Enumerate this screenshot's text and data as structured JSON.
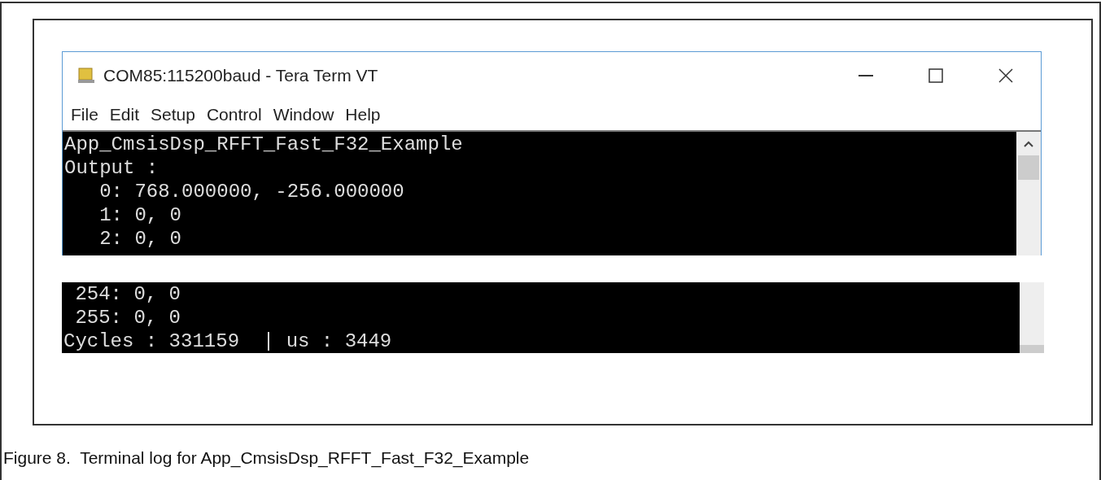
{
  "window": {
    "title": "COM85:115200baud - Tera Term VT"
  },
  "menu": [
    "File",
    "Edit",
    "Setup",
    "Control",
    "Window",
    "Help"
  ],
  "terminal_top": {
    "lines": [
      "App_CmsisDsp_RFFT_Fast_F32_Example",
      "Output :",
      "   0: 768.000000, -256.000000",
      "   1: 0, 0",
      "   2: 0, 0"
    ]
  },
  "terminal_bottom": {
    "lines": [
      " 254: 0, 0",
      " 255: 0, 0",
      "Cycles : 331159  | us : 3449"
    ]
  },
  "caption": "Figure 8.  Terminal log for App_CmsisDsp_RFFT_Fast_F32_Example"
}
